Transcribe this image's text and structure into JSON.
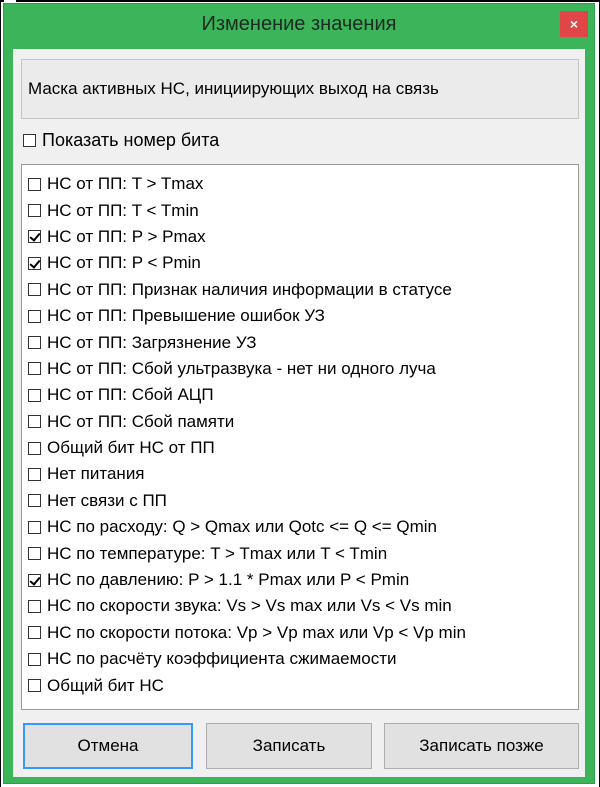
{
  "window": {
    "title": "Изменение значения",
    "close_glyph": "×",
    "accent_color": "#3cb55a"
  },
  "description": "Маска активных НС, инициирующих выход на связь",
  "show_bits": {
    "label": "Показать номер бита",
    "checked": false
  },
  "items": [
    {
      "label": "НС от ПП: T > Tmax",
      "checked": false
    },
    {
      "label": "НС от ПП: T < Tmin",
      "checked": false
    },
    {
      "label": "НС от ПП: P > Pmax",
      "checked": true
    },
    {
      "label": "НС от ПП: P < Pmin",
      "checked": true
    },
    {
      "label": "НС от ПП: Признак наличия информации в статусе",
      "checked": false
    },
    {
      "label": "НС от ПП: Превышение ошибок УЗ",
      "checked": false
    },
    {
      "label": "НС от ПП: Загрязнение УЗ",
      "checked": false
    },
    {
      "label": "НС от ПП: Сбой ультразвука - нет ни одного луча",
      "checked": false
    },
    {
      "label": "НС от ПП: Сбой АЦП",
      "checked": false
    },
    {
      "label": "НС от ПП: Сбой памяти",
      "checked": false
    },
    {
      "label": "Общий бит НС от ПП",
      "checked": false
    },
    {
      "label": "Нет питания",
      "checked": false
    },
    {
      "label": "Нет связи с ПП",
      "checked": false
    },
    {
      "label": "НС по расходу: Q > Qmax или Qotc <= Q <= Qmin",
      "checked": false
    },
    {
      "label": "НС по температуре: T > Tmax или T < Tmin",
      "checked": false
    },
    {
      "label": "НС по давлению: P > 1.1 * Pmax или P < Pmin",
      "checked": true
    },
    {
      "label": "НС по скорости звука: Vs > Vs max или Vs < Vs min",
      "checked": false
    },
    {
      "label": "НС по скорости потока: Vp > Vp max или Vp < Vp min",
      "checked": false
    },
    {
      "label": "НС по расчёту коэффициента сжимаемости",
      "checked": false
    },
    {
      "label": "Общий бит НС",
      "checked": false
    }
  ],
  "buttons": {
    "cancel": "Отмена",
    "save": "Записать",
    "save_later": "Записать позже"
  }
}
